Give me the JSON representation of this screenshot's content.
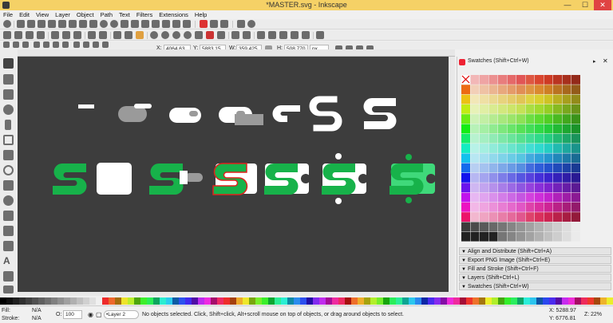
{
  "window": {
    "title": "*MASTER.svg - Inkscape",
    "minimize": "—",
    "maximize": "☐",
    "close": "✕"
  },
  "menu": [
    "File",
    "Edit",
    "View",
    "Layer",
    "Object",
    "Path",
    "Text",
    "Filters",
    "Extensions",
    "Help"
  ],
  "tool_controls": {
    "x_label": "X:",
    "x_value": "4064.63",
    "y_label": "Y:",
    "y_value": "5883.15",
    "w_label": "W:",
    "w_value": "359.425",
    "h_label": "H:",
    "h_value": "508.770",
    "unit": "px"
  },
  "dock": {
    "swatches_title": "Swatches (Shift+Ctrl+W)",
    "panels": [
      "Align and Distribute (Shift+Ctrl+A)",
      "Export PNG Image (Shift+Ctrl+E)",
      "Fill and Stroke (Shift+Ctrl+F)",
      "Layers (Shift+Ctrl+L)",
      "Swatches (Shift+Ctrl+W)"
    ]
  },
  "status": {
    "fill_label": "Fill:",
    "fill_value": "N/A",
    "stroke_label": "Stroke:",
    "stroke_value": "N/A",
    "opacity_label": "O:",
    "opacity_value": "100",
    "layer": "•Layer 2",
    "message": "No objects selected. Click, Shift+click, Alt+scroll mouse on top of objects, or drag around objects to select.",
    "coord_x": "X: 5288.97",
    "coord_y": "Y: 6776.81",
    "zoom_label": "Z:",
    "zoom_value": "22%"
  },
  "colors": {
    "titlebar": "#f5d166",
    "canvas": "#3d3d3d",
    "logo_green": "#17b24a",
    "logo_light_green": "#3fd97a",
    "white": "#ffffff",
    "gray_shape": "#9a9a9a",
    "selection_red": "#e0201c"
  },
  "icons": [
    "app-icon",
    "selector-icon",
    "node-icon",
    "tweak-icon",
    "zoom-icon",
    "measure-icon",
    "rect-icon",
    "box3d-icon",
    "ellipse-icon",
    "star-icon",
    "spiral-icon",
    "pencil-icon",
    "pen-icon",
    "calligraphy-icon",
    "text-icon",
    "spray-icon",
    "eraser-icon",
    "bucket-icon",
    "gradient-icon",
    "mesh-icon",
    "dropper-icon",
    "connector-icon"
  ]
}
